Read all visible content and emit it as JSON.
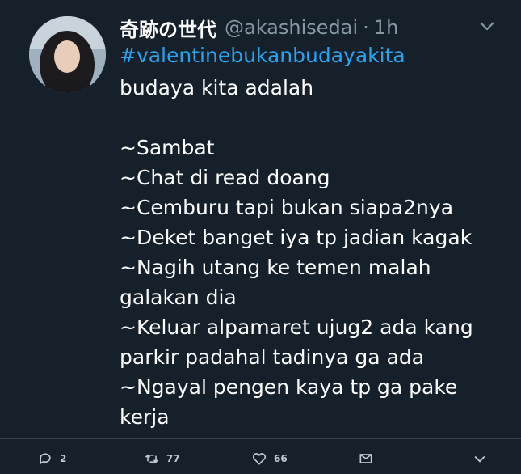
{
  "tweet": {
    "display_name": "奇跡の世代",
    "handle": "@akashisedai",
    "separator": "·",
    "time": "1h",
    "hashtag": "#valentinebukanbudayakita",
    "lines_before_blank": [
      "budaya kita adalah"
    ],
    "lines_after_blank": [
      "~Sambat",
      "~Chat di read doang",
      "~Cemburu tapi bukan siapa2nya",
      "~Deket banget iya tp jadian kagak",
      "~Nagih utang ke temen malah galakan dia",
      "~Keluar alpamaret ujug2 ada kang parkir padahal tadinya ga ada",
      "~Ngayal pengen kaya tp ga pake kerja"
    ]
  },
  "actions": {
    "reply_count": "2",
    "retweet_count": "77",
    "like_count": "66"
  },
  "icons": [
    "chevron-down-icon",
    "reply-icon",
    "retweet-icon",
    "like-icon",
    "message-icon",
    "chevron-down-icon"
  ],
  "colors": {
    "background": "#15202b",
    "accent": "#2aa3ef",
    "muted": "#8899a6"
  }
}
